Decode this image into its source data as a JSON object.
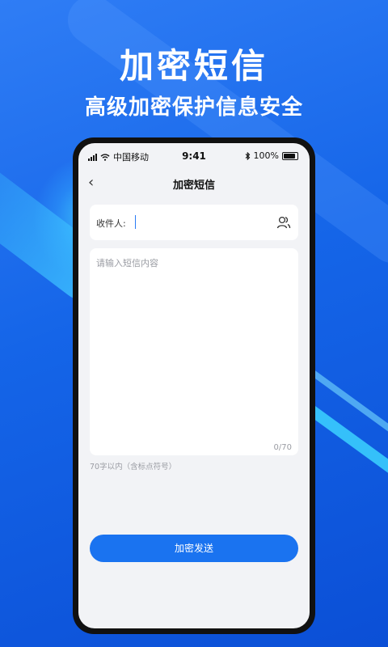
{
  "promo": {
    "headline": "加密短信",
    "subheadline": "高级加密保护信息安全"
  },
  "statusbar": {
    "carrier": "中国移动",
    "time": "9:41",
    "battery": "100%"
  },
  "navbar": {
    "title": "加密短信"
  },
  "recipient": {
    "label": "收件人:",
    "icon": "contacts-icon"
  },
  "message": {
    "placeholder": "请输入短信内容",
    "counter": "0/70",
    "hint": "70字以内（含标点符号）"
  },
  "actions": {
    "send_label": "加密发送"
  },
  "colors": {
    "background": "#1565e8",
    "accent": "#1a73f0",
    "screen_bg": "#f2f3f6"
  }
}
